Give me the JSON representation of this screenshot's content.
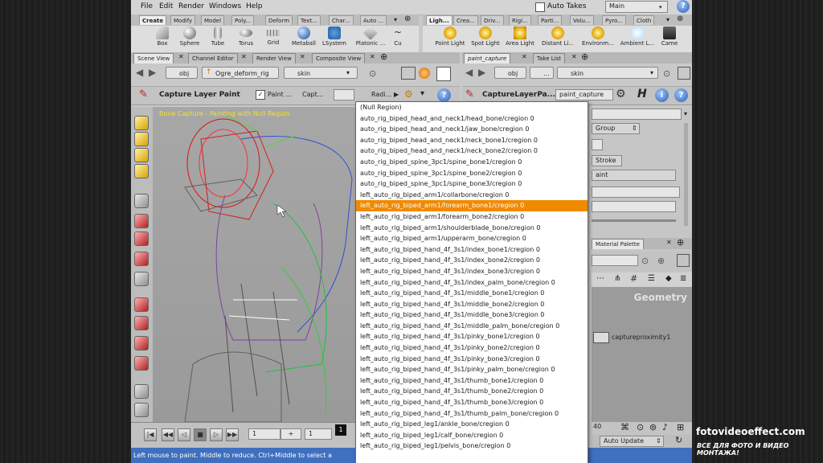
{
  "menubar": {
    "items": [
      "File",
      "Edit",
      "Render",
      "Windows",
      "Help"
    ],
    "auto_takes": "Auto Takes",
    "desktop": "Main"
  },
  "left_shelf": {
    "tabs": [
      "Create",
      "Modify",
      "Model",
      "Poly...",
      "Deform",
      "Text...",
      "Char...",
      "Auto ..."
    ],
    "tools": [
      {
        "label": "Box",
        "icon": "box-icon"
      },
      {
        "label": "Sphere",
        "icon": "sphere-icon"
      },
      {
        "label": "Tube",
        "icon": "tube-icon"
      },
      {
        "label": "Torus",
        "icon": "torus-icon"
      },
      {
        "label": "Grid",
        "icon": "grid-icon"
      },
      {
        "label": "Metaball",
        "icon": "metaball-icon"
      },
      {
        "label": "LSystem",
        "icon": "lsystem-icon"
      },
      {
        "label": "Platonic ...",
        "icon": "platonic-icon"
      },
      {
        "label": "Cu",
        "icon": "curve-icon"
      }
    ]
  },
  "right_shelf": {
    "tabs": [
      "Ligh...",
      "Crea...",
      "Driv...",
      "Rigi...",
      "Parti...",
      "Volu...",
      "Pyro...",
      "Cloth"
    ],
    "tools": [
      {
        "label": "Point Light",
        "icon": "point-light-icon"
      },
      {
        "label": "Spot Light",
        "icon": "spot-light-icon"
      },
      {
        "label": "Area Light",
        "icon": "area-light-icon"
      },
      {
        "label": "Distant Li...",
        "icon": "distant-light-icon"
      },
      {
        "label": "Environm...",
        "icon": "environment-light-icon"
      },
      {
        "label": "Ambient L...",
        "icon": "ambient-light-icon"
      },
      {
        "label": "Came",
        "icon": "camera-icon"
      }
    ]
  },
  "left_pane": {
    "tabs": [
      "Scene View",
      "Channel Editor",
      "Render View",
      "Composite View"
    ],
    "path": {
      "obj": "obj",
      "node": "Ogre_deform_rig",
      "sub": "skin"
    },
    "tool": {
      "name": "Capture Layer Paint",
      "check_label": "Paint ...",
      "capt": "Capt...",
      "radius": "Radi..."
    },
    "viewport_hint": "Bone Capture - Painting with Null Region"
  },
  "right_pane": {
    "tabs": [
      "paint_capture",
      "Take List"
    ],
    "path": {
      "obj": "obj",
      "dots": "...",
      "sub": "skin"
    },
    "op_name": "CaptureLayerPa...",
    "op_field": "paint_capture",
    "params": {
      "group": "Group",
      "stroke": "Stroke",
      "paint": "aint"
    },
    "lower_tab": "Material Palette",
    "network_label": "Geometry",
    "node": "captureproximity1",
    "auto_update": "Auto Update",
    "frame_end": "40"
  },
  "playbar": {
    "frame": "1",
    "start": "1",
    "current": "1"
  },
  "status": "Left mouse to paint.  Middle to reduce.  Ctrl+Middle to select a",
  "dropdown": {
    "items": [
      "(Null Region)",
      "auto_rig_biped_head_and_neck1/head_bone/cregion 0",
      "auto_rig_biped_head_and_neck1/jaw_bone/cregion 0",
      "auto_rig_biped_head_and_neck1/neck_bone1/cregion 0",
      "auto_rig_biped_head_and_neck1/neck_bone2/cregion 0",
      "auto_rig_biped_spine_3pc1/spine_bone1/cregion 0",
      "auto_rig_biped_spine_3pc1/spine_bone2/cregion 0",
      "auto_rig_biped_spine_3pc1/spine_bone3/cregion 0",
      "left_auto_rig_biped_arm1/collarbone/cregion 0",
      "left_auto_rig_biped_arm1/forearm_bone1/cregion 0",
      "left_auto_rig_biped_arm1/forearm_bone2/cregion 0",
      "left_auto_rig_biped_arm1/shoulderblade_bone/cregion 0",
      "left_auto_rig_biped_arm1/upperarm_bone/cregion 0",
      "left_auto_rig_biped_hand_4f_3s1/index_bone1/cregion 0",
      "left_auto_rig_biped_hand_4f_3s1/index_bone2/cregion 0",
      "left_auto_rig_biped_hand_4f_3s1/index_bone3/cregion 0",
      "left_auto_rig_biped_hand_4f_3s1/index_palm_bone/cregion 0",
      "left_auto_rig_biped_hand_4f_3s1/middle_bone1/cregion 0",
      "left_auto_rig_biped_hand_4f_3s1/middle_bone2/cregion 0",
      "left_auto_rig_biped_hand_4f_3s1/middle_bone3/cregion 0",
      "left_auto_rig_biped_hand_4f_3s1/middle_palm_bone/cregion 0",
      "left_auto_rig_biped_hand_4f_3s1/pinky_bone1/cregion 0",
      "left_auto_rig_biped_hand_4f_3s1/pinky_bone2/cregion 0",
      "left_auto_rig_biped_hand_4f_3s1/pinky_bone3/cregion 0",
      "left_auto_rig_biped_hand_4f_3s1/pinky_palm_bone/cregion 0",
      "left_auto_rig_biped_hand_4f_3s1/thumb_bone1/cregion 0",
      "left_auto_rig_biped_hand_4f_3s1/thumb_bone2/cregion 0",
      "left_auto_rig_biped_hand_4f_3s1/thumb_bone3/cregion 0",
      "left_auto_rig_biped_hand_4f_3s1/thumb_palm_bone/cregion 0",
      "left_auto_rig_biped_leg1/ankle_bone/cregion 0",
      "left_auto_rig_biped_leg1/calf_bone/cregion 0",
      "left_auto_rig_biped_leg1/pelvis_bone/cregion 0"
    ],
    "highlighted": 9
  },
  "watermark": {
    "site": "fotovideoeffect.com",
    "tagline": "ВСЕ ДЛЯ ФОТО И ВИДЕО МОНТАЖА!"
  },
  "colors": {
    "highlight": "#f08a00",
    "status_bg": "#3f6fbf",
    "hint": "#f0e030"
  }
}
